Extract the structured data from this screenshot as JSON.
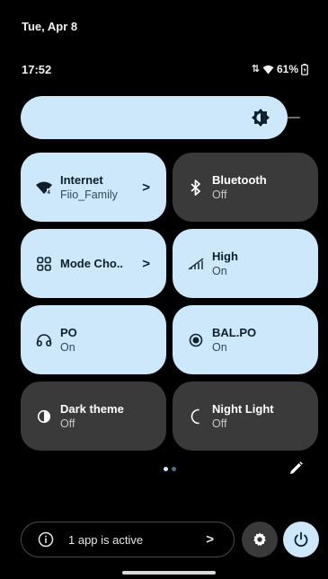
{
  "status": {
    "date": "Tue, Apr 8",
    "time": "17:52",
    "battery": "61%"
  },
  "brightness": {
    "level": 0.9
  },
  "tiles": [
    {
      "title": "Internet",
      "subtitle": "Fiio_Family",
      "state": "on",
      "icon": "wifi-icon",
      "chevron": ">"
    },
    {
      "title": "Bluetooth",
      "subtitle": "Off",
      "state": "off",
      "icon": "bluetooth-icon"
    },
    {
      "title": "Mode Cho..",
      "subtitle": "",
      "state": "on",
      "icon": "mode-chooser-icon",
      "chevron": ">"
    },
    {
      "title": "High",
      "subtitle": "On",
      "state": "on",
      "icon": "gain-icon"
    },
    {
      "title": "PO",
      "subtitle": "On",
      "state": "on",
      "icon": "headphones-icon"
    },
    {
      "title": "BAL.PO",
      "subtitle": "On",
      "state": "on",
      "icon": "radio-dot-icon"
    },
    {
      "title": "Dark theme",
      "subtitle": "Off",
      "state": "off",
      "icon": "dark-theme-icon"
    },
    {
      "title": "Night Light",
      "subtitle": "Off",
      "state": "off",
      "icon": "moon-icon"
    }
  ],
  "footer": {
    "active_label": "1 app is active",
    "active_chevron": ">"
  },
  "colors": {
    "tile_on": "#cde8fb",
    "tile_off": "#3a3a3a",
    "background": "#000000"
  }
}
